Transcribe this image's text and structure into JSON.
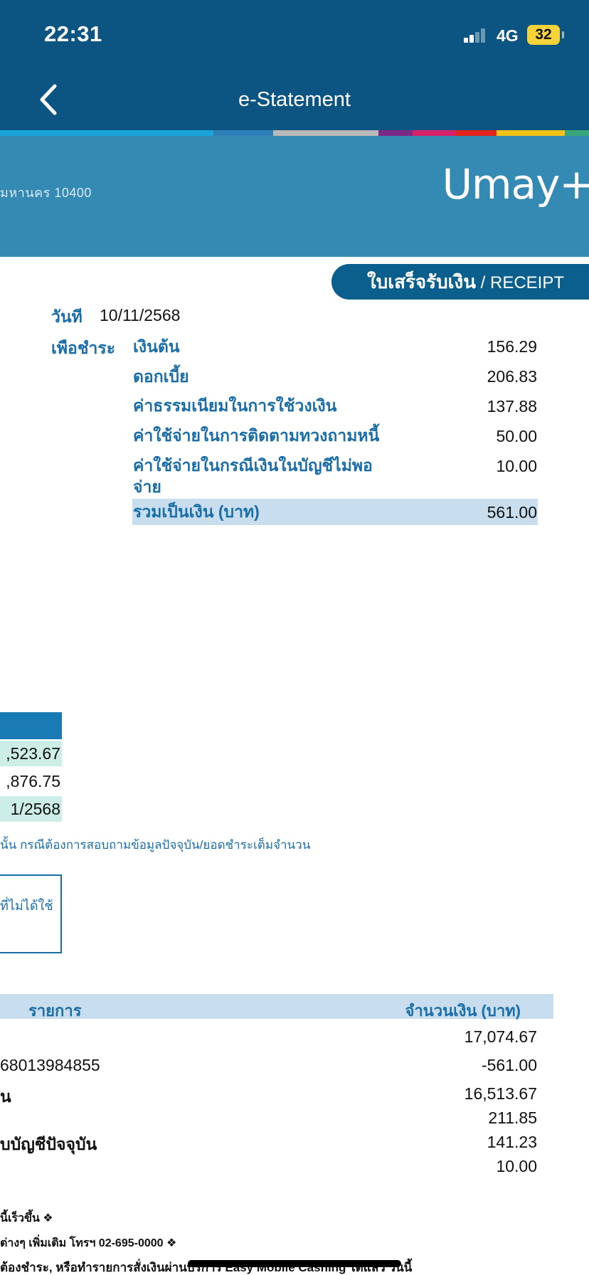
{
  "status": {
    "time": "22:31",
    "network": "4G",
    "battery": "32"
  },
  "nav": {
    "title": "e-Statement"
  },
  "stripe_colors": [
    "#1aa3d9",
    "#1aa3d9",
    "#b9b9b9",
    "#7a2a86",
    "#d6216b",
    "#e2241f",
    "#f3c21a",
    "#3aa57a"
  ],
  "header": {
    "address_fragment": "มหานคร 10400",
    "brand": "Umay+"
  },
  "receipt": {
    "title_th": "ใบเสร็จรับเงิน",
    "title_sep_en": " / RECEIPT",
    "date_label": "วันที",
    "date_value": "10/11/2568",
    "pay_for_label": "เพือชำระ",
    "items": [
      {
        "label": "เงินต้น",
        "amount": "156.29"
      },
      {
        "label": "ดอกเบี้ย",
        "amount": "206.83"
      },
      {
        "label": "ค่าธรรมเนียมในการใช้วงเงิน",
        "amount": "137.88"
      },
      {
        "label": "ค่าใช้จ่ายในการติดตามทวงถามหนี้",
        "amount": "50.00"
      },
      {
        "label_line1": "ค่าใช้จ่ายในกรณีเงินในบัญชีไม่พอ",
        "label_line2": "จ่าย",
        "amount": "10.00"
      }
    ],
    "total_label": "รวมเป็นเงิน (บาท)",
    "total_amount": "561.00"
  },
  "summary": {
    "row1": ",523.67",
    "row2": ",876.75",
    "row3": "1/2568",
    "note": "นั้น กรณีต้องการสอบถามข้อมูลปัจจุบัน/ยอดชำระเต็มจำนวน",
    "notice": "ที่ไม่ได้ใช้"
  },
  "transactions": {
    "col_item": "รายการ",
    "col_amount": "จำนวนเงิน (บาท)",
    "rows": [
      {
        "label": "",
        "amount": "17,074.67"
      },
      {
        "label": "68013984855",
        "amount": "-561.00"
      },
      {
        "label": "น",
        "amount": "16,513.67"
      },
      {
        "label": "",
        "amount": "211.85"
      },
      {
        "label": "บบัญชีปัจจุบัน",
        "amount": "141.23"
      },
      {
        "label": "",
        "amount": "10.00"
      }
    ]
  },
  "footnotes": {
    "line1": "นี้เร็วขึ้น ❖",
    "line2": "ต่างๆ เพิ่มเติม โทรฯ 02-695-0000 ❖",
    "line3": "ต้องชำระ, หรือทำรายการสั่งเงินผ่านบริการ Easy Mobile Cashing ได้แล้ว วันนี้"
  }
}
